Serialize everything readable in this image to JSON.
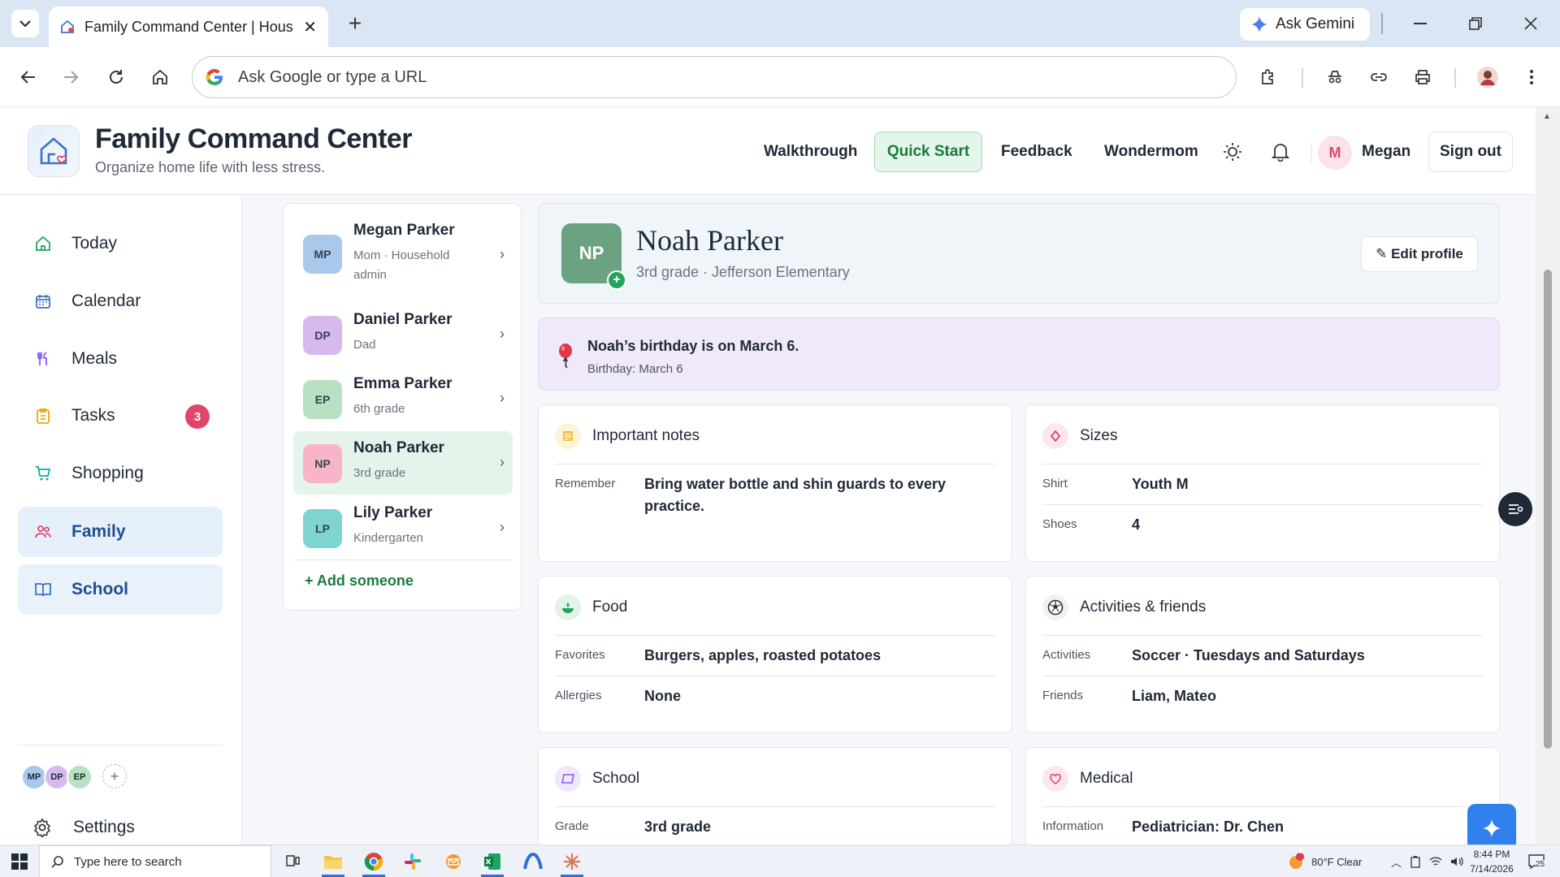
{
  "browser": {
    "tab_title": "Family Command Center | Hous",
    "gemini_label": "Ask Gemini",
    "omnibox_placeholder": "Ask Google or type a URL"
  },
  "header": {
    "title": "Family Command Center",
    "subtitle": "Organize home life with less stress.",
    "links": [
      "Walkthrough",
      "Quick Start",
      "Feedback",
      "Wondermom"
    ],
    "user_initial": "M",
    "user_name": "Megan",
    "signout": "Sign out"
  },
  "sidebar": {
    "items": [
      {
        "label": "Today",
        "icon": "home-icon"
      },
      {
        "label": "Calendar",
        "icon": "calendar-icon"
      },
      {
        "label": "Meals",
        "icon": "utensils-icon"
      },
      {
        "label": "Tasks",
        "icon": "clipboard-icon",
        "badge": "3"
      },
      {
        "label": "Shopping",
        "icon": "cart-icon"
      },
      {
        "label": "Family",
        "icon": "people-icon"
      },
      {
        "label": "School",
        "icon": "book-icon"
      }
    ],
    "mini_avatars": [
      "MP",
      "DP",
      "EP"
    ],
    "mini_add": "+",
    "settings": "Settings"
  },
  "members": {
    "list": [
      {
        "initials": "MP",
        "name": "Megan Parker",
        "role": "Mom · Household admin",
        "color": "#a9c8ee"
      },
      {
        "initials": "DP",
        "name": "Daniel Parker",
        "role": "Dad",
        "color": "#d7b8ef"
      },
      {
        "initials": "EP",
        "name": "Emma Parker",
        "role": "6th grade",
        "color": "#b8e0c2"
      },
      {
        "initials": "NP",
        "name": "Noah Parker",
        "role": "3rd grade",
        "color": "#f7b5c7"
      },
      {
        "initials": "LP",
        "name": "Lily Parker",
        "role": "Kindergarten",
        "color": "#7dd4d0"
      }
    ],
    "add_label": "+ Add someone"
  },
  "profile": {
    "initials": "NP",
    "plus": "+",
    "name": "Noah Parker",
    "subtitle": "3rd grade · Jefferson Elementary",
    "edit_label": "✎ Edit profile"
  },
  "birthday": {
    "title": "Noah’s birthday is on March 6.",
    "detail": "Birthday: March 6"
  },
  "cards": {
    "notes": {
      "title": "Important notes",
      "rows": [
        {
          "label": "Remember",
          "value": "Bring water bottle and shin guards to every practice."
        }
      ]
    },
    "sizes": {
      "title": "Sizes",
      "rows": [
        {
          "label": "Shirt",
          "value": "Youth M"
        },
        {
          "label": "Shoes",
          "value": "4"
        }
      ]
    },
    "food": {
      "title": "Food",
      "rows": [
        {
          "label": "Favorites",
          "value": "Burgers, apples, roasted potatoes"
        },
        {
          "label": "Allergies",
          "value": "None"
        }
      ]
    },
    "activities": {
      "title": "Activities & friends",
      "rows": [
        {
          "label": "Activities",
          "value": "Soccer · Tuesdays and Saturdays"
        },
        {
          "label": "Friends",
          "value": "Liam, Mateo"
        }
      ]
    },
    "school": {
      "title": "School",
      "rows": [
        {
          "label": "Grade",
          "value": "3rd grade"
        }
      ]
    },
    "medical": {
      "title": "Medical",
      "rows": [
        {
          "label": "Information",
          "value": "Pediatrician: Dr. Chen"
        }
      ]
    }
  },
  "taskbar": {
    "search_placeholder": "Type here to search",
    "weather": "80°F  Clear",
    "weather_badge": "6",
    "time": "8:44 PM",
    "date": "7/14/2026",
    "notif_count": "25"
  }
}
